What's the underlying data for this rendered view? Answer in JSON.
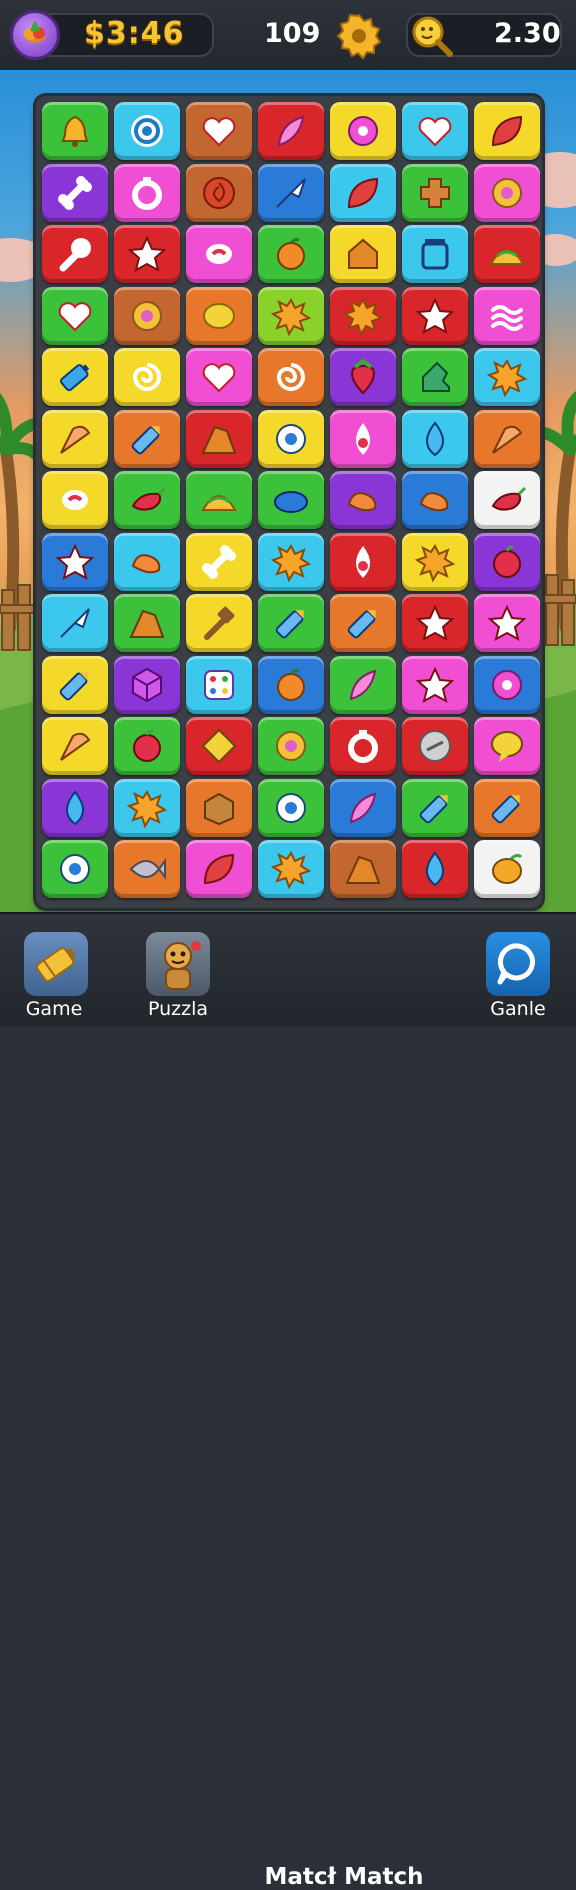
{
  "header": {
    "coins": "$3:46",
    "level": "109",
    "hints": "2.30"
  },
  "board": {
    "rows": 13,
    "cols": 7,
    "colors": {
      "G": "#3cc23a",
      "C": "#3cc7ec",
      "O": "#e7772a",
      "R": "#d9262a",
      "Y": "#f4d92a",
      "B": "#2a7ad8",
      "P": "#8a35d6",
      "M": "#f04fd3",
      "L": "#8ad22a",
      "Br": "#c4662f",
      "W": "#f3f3f3"
    },
    "tiles": [
      [
        "G",
        "C",
        "Br",
        "R",
        "Y",
        "C",
        "Y"
      ],
      [
        "P",
        "M",
        "Br",
        "B",
        "C",
        "G",
        "M"
      ],
      [
        "R",
        "R",
        "M",
        "G",
        "Y",
        "C",
        "R"
      ],
      [
        "G",
        "Br",
        "O",
        "L",
        "R",
        "R",
        "M"
      ],
      [
        "Y",
        "Y",
        "M",
        "O",
        "P",
        "G",
        "C"
      ],
      [
        "Y",
        "O",
        "R",
        "Y",
        "M",
        "C",
        "O"
      ],
      [
        "Y",
        "G",
        "G",
        "G",
        "P",
        "B",
        "W"
      ],
      [
        "B",
        "C",
        "Y",
        "C",
        "R",
        "Y",
        "P"
      ],
      [
        "C",
        "G",
        "Y",
        "G",
        "O",
        "R",
        "M"
      ],
      [
        "Y",
        "P",
        "C",
        "B",
        "G",
        "M",
        "B"
      ],
      [
        "Y",
        "G",
        "R",
        "G",
        "R",
        "R",
        "M"
      ],
      [
        "P",
        "C",
        "O",
        "G",
        "B",
        "G",
        "O"
      ],
      [
        "G",
        "O",
        "M",
        "C",
        "Br",
        "R",
        "W"
      ]
    ],
    "icons": [
      [
        "bell-icon",
        "target-icon",
        "heart-icon",
        "feather-icon",
        "flower-icon",
        "heart-icon",
        "leaf-icon"
      ],
      [
        "bone-icon",
        "ring-icon",
        "rose-icon",
        "arrow-icon",
        "leaf-icon",
        "cross-icon",
        "donut-icon"
      ],
      [
        "wrench-icon",
        "star-icon",
        "candy-icon",
        "orange-icon",
        "house-icon",
        "jar-icon",
        "taco-icon"
      ],
      [
        "heart-icon",
        "donut-icon",
        "lemon-icon",
        "splat-icon",
        "splat-icon",
        "star-icon",
        "wave-icon"
      ],
      [
        "battery-icon",
        "swirl-icon",
        "heart-icon",
        "swirl-icon",
        "strawberry-icon",
        "boot-icon",
        "splat-icon"
      ],
      [
        "cone-icon",
        "pencil-icon",
        "wedge-icon",
        "badge-icon",
        "drop-ring-icon",
        "drop-icon",
        "cone-icon"
      ],
      [
        "candy-icon",
        "chili-icon",
        "taco-icon",
        "blob-icon",
        "bean-icon",
        "bean-icon",
        "chili-icon"
      ],
      [
        "star-icon",
        "bean-icon",
        "bone-icon",
        "splat-icon",
        "drop-ring-icon",
        "splat-icon",
        "apple-icon"
      ],
      [
        "arrow-icon",
        "wedge-icon",
        "hammer-icon",
        "pencil-icon",
        "pencil-icon",
        "star-icon",
        "star-icon"
      ],
      [
        "pencil-icon",
        "cube-icon",
        "dots-icon",
        "orange-icon",
        "feather-icon",
        "star-icon",
        "flower-icon"
      ],
      [
        "cone-icon",
        "apple-icon",
        "diamond-icon",
        "donut-icon",
        "ring-icon",
        "coin-icon",
        "chat-icon"
      ],
      [
        "drop-icon",
        "splat-icon",
        "box-icon",
        "badge-icon",
        "feather-icon",
        "pencil-icon",
        "pencil-icon"
      ],
      [
        "badge-icon",
        "fish-icon",
        "leaf-icon",
        "splat-icon",
        "wedge-icon",
        "drop-icon",
        "mango-icon"
      ]
    ]
  },
  "footer": {
    "nav_game": "Game",
    "nav_puzzle": "Puzzla",
    "title": "Matcł Match",
    "nav_ganle": "Ganle"
  }
}
